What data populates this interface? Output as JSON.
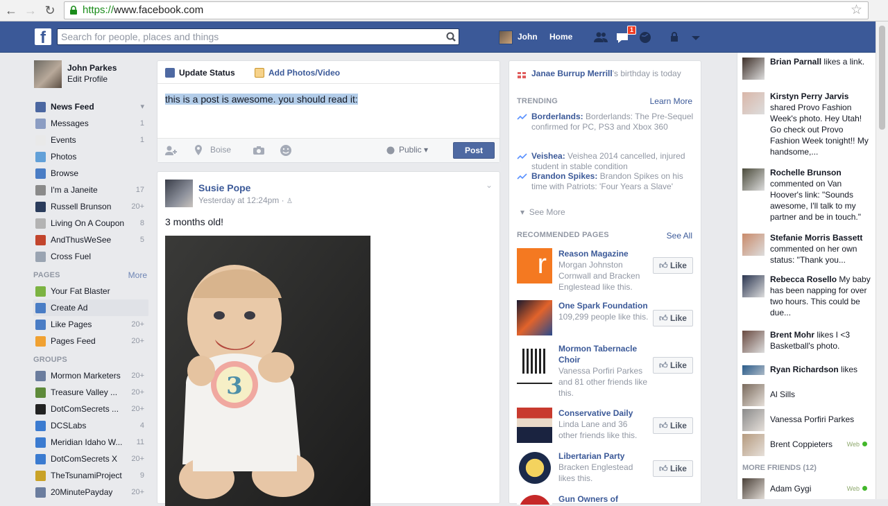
{
  "browser": {
    "url_scheme": "https://",
    "url_host": "www.facebook.com"
  },
  "topbar": {
    "search_placeholder": "Search for people, places and things",
    "user_name": "John",
    "home_label": "Home",
    "notification_count": "1"
  },
  "leftnav": {
    "profile_name": "John Parkes",
    "edit_profile": "Edit Profile",
    "favorites": [
      {
        "label": "News Feed",
        "count": "",
        "icon": "news-feed-icon",
        "color": "#4b67a1"
      },
      {
        "label": "Messages",
        "count": "1",
        "icon": "messages-icon",
        "color": "#8b9dc3"
      },
      {
        "label": "Events",
        "count": "1",
        "icon": "events-icon",
        "color": "#e9e9e9"
      },
      {
        "label": "Photos",
        "count": "",
        "icon": "photos-icon",
        "color": "#62a0d8"
      },
      {
        "label": "Browse",
        "count": "",
        "icon": "browse-icon",
        "color": "#4a7dc5"
      },
      {
        "label": "I'm a Janeite",
        "count": "17",
        "icon": "group-icon",
        "color": "#8a8a8a"
      },
      {
        "label": "Russell Brunson",
        "count": "20+",
        "icon": "group-icon",
        "color": "#2b3c5c"
      },
      {
        "label": "Living On A Coupon",
        "count": "8",
        "icon": "group-icon",
        "color": "#b3b3b3"
      },
      {
        "label": "AndThusWeSee",
        "count": "5",
        "icon": "group-icon",
        "color": "#c2452d"
      },
      {
        "label": "Cross Fuel",
        "count": "",
        "icon": "group-icon",
        "color": "#9aa4b2"
      }
    ],
    "pages_heading": "PAGES",
    "pages_more": "More",
    "pages": [
      {
        "label": "Your Fat Blaster",
        "count": "",
        "icon": "page-icon",
        "color": "#7cb342"
      },
      {
        "label": "Create Ad",
        "count": "",
        "icon": "ad-icon",
        "color": "#4a7dc5"
      },
      {
        "label": "Like Pages",
        "count": "20+",
        "icon": "like-pages-icon",
        "color": "#4a7dc5"
      },
      {
        "label": "Pages Feed",
        "count": "20+",
        "icon": "pages-feed-icon",
        "color": "#f0a132"
      }
    ],
    "groups_heading": "GROUPS",
    "groups": [
      {
        "label": "Mormon Marketers",
        "count": "20+",
        "icon": "globe-icon",
        "color": "#6b7d9e"
      },
      {
        "label": "Treasure Valley ...",
        "count": "20+",
        "icon": "tree-icon",
        "color": "#5e8a3a"
      },
      {
        "label": "DotComSecrets ...",
        "count": "20+",
        "icon": "hat-icon",
        "color": "#222222"
      },
      {
        "label": "DCSLabs",
        "count": "4",
        "icon": "flask-icon",
        "color": "#3b7bd0"
      },
      {
        "label": "Meridian Idaho W...",
        "count": "11",
        "icon": "flask-icon",
        "color": "#3b7bd0"
      },
      {
        "label": "DotComSecrets X",
        "count": "20+",
        "icon": "flask-icon",
        "color": "#3b7bd0"
      },
      {
        "label": "TheTsunamiProject",
        "count": "9",
        "icon": "trophy-icon",
        "color": "#c9a227"
      },
      {
        "label": "20MinutePayday",
        "count": "20+",
        "icon": "globe-icon",
        "color": "#6b7d9e"
      }
    ]
  },
  "composer": {
    "tab_status": "Update Status",
    "tab_photos": "Add Photos/Video",
    "text": "this is a post is awesome. you should read it:",
    "location": "Boise",
    "privacy": "Public",
    "post_button": "Post"
  },
  "post": {
    "author": "Susie Pope",
    "time": "Yesterday at 12:24pm ·",
    "text": "3 months old!"
  },
  "rightcol": {
    "birthday_name": "Janae Burrup Merrill",
    "birthday_suffix": "'s birthday is today",
    "trending_heading": "TRENDING",
    "trending_learn_more": "Learn More",
    "trending": [
      {
        "topic": "Borderlands:",
        "text": " Borderlands: The Pre-Sequel confirmed for PC, PS3 and Xbox 360"
      },
      {
        "topic": "Veishea:",
        "text": " Veishea 2014 cancelled, injured student in stable condition"
      },
      {
        "topic": "Brandon Spikes:",
        "text": " Brandon Spikes on his time with Patriots: 'Four Years a Slave'"
      }
    ],
    "see_more": "See More",
    "rec_heading": "RECOMMENDED PAGES",
    "rec_see_all": "See All",
    "like_label": "Like",
    "recommended": [
      {
        "name": "Reason Magazine",
        "desc": "Morgan Johnston Cornwall and Bracken Englestead like this."
      },
      {
        "name": "One Spark Foundation",
        "desc": "109,299 people like this."
      },
      {
        "name": "Mormon Tabernacle Choir",
        "desc": "Vanessa Porfiri Parkes and 81 other friends like this."
      },
      {
        "name": "Conservative Daily",
        "desc": "Linda Lane and 36 other friends like this."
      },
      {
        "name": "Libertarian Party",
        "desc": "Bracken Englestead likes this."
      },
      {
        "name": "Gun Owners of",
        "desc": ""
      }
    ]
  },
  "ticker": {
    "items": [
      {
        "name": "Brian Parnall",
        "text": " likes a link."
      },
      {
        "name": "Kirstyn Perry Jarvis",
        "text": " shared Provo Fashion Week's photo. Hey Utah! Go check out Provo Fashion Week tonight!! My handsome,..."
      },
      {
        "name": "Rochelle Brunson",
        "text": " commented on Van Hoover's link: \"Sounds awesome, I'll talk to my partner and be in touch.\""
      },
      {
        "name": "Stefanie Morris Bassett",
        "text": " commented on her own status: \"Thank you..."
      },
      {
        "name": "Rebecca Rosello",
        "text": " My baby has been napping for over two hours. This could be due..."
      },
      {
        "name": "Brent Mohr",
        "text": " likes I <3 Basketball's photo."
      },
      {
        "name": "Ryan Richardson",
        "text": " likes"
      }
    ],
    "friends": [
      {
        "name": "Al Sills",
        "status": ""
      },
      {
        "name": "Vanessa Porfiri Parkes",
        "status": ""
      },
      {
        "name": "Brent Coppieters",
        "status": "Web"
      }
    ],
    "more_friends": "MORE FRIENDS (12)",
    "more_friends_list": [
      {
        "name": "Adam Gygi",
        "status": "Web"
      }
    ]
  }
}
